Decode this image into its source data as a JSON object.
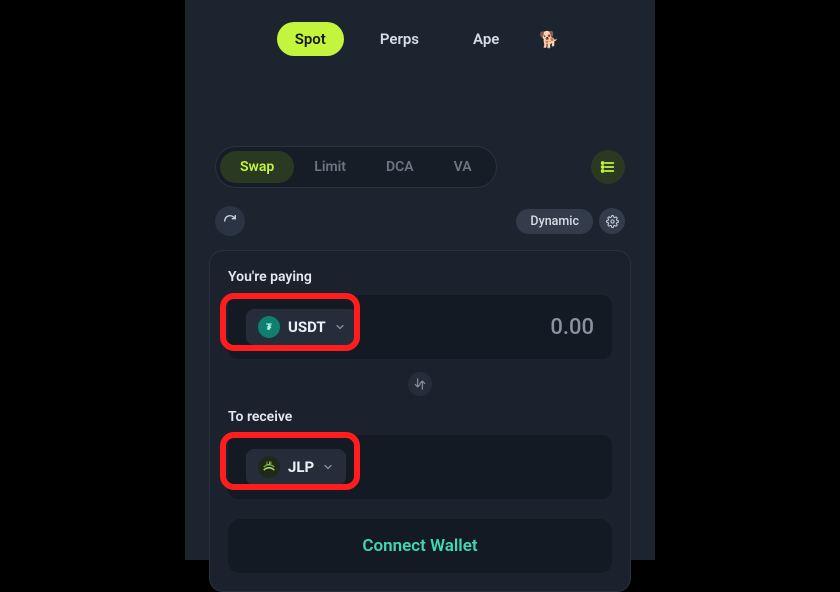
{
  "topnav": {
    "items": [
      {
        "label": "Spot",
        "active": true
      },
      {
        "label": "Perps",
        "active": false
      },
      {
        "label": "Ape",
        "active": false
      }
    ],
    "emoji": "🐕"
  },
  "mode_tabs": {
    "items": [
      {
        "label": "Swap",
        "active": true
      },
      {
        "label": "Limit",
        "active": false
      },
      {
        "label": "DCA",
        "active": false
      },
      {
        "label": "VA",
        "active": false
      }
    ]
  },
  "controls": {
    "dynamic_label": "Dynamic"
  },
  "swap": {
    "pay_label": "You're paying",
    "pay_token": "USDT",
    "pay_amount": "0.00",
    "receive_label": "To receive",
    "receive_token": "JLP",
    "connect_label": "Connect Wallet"
  }
}
